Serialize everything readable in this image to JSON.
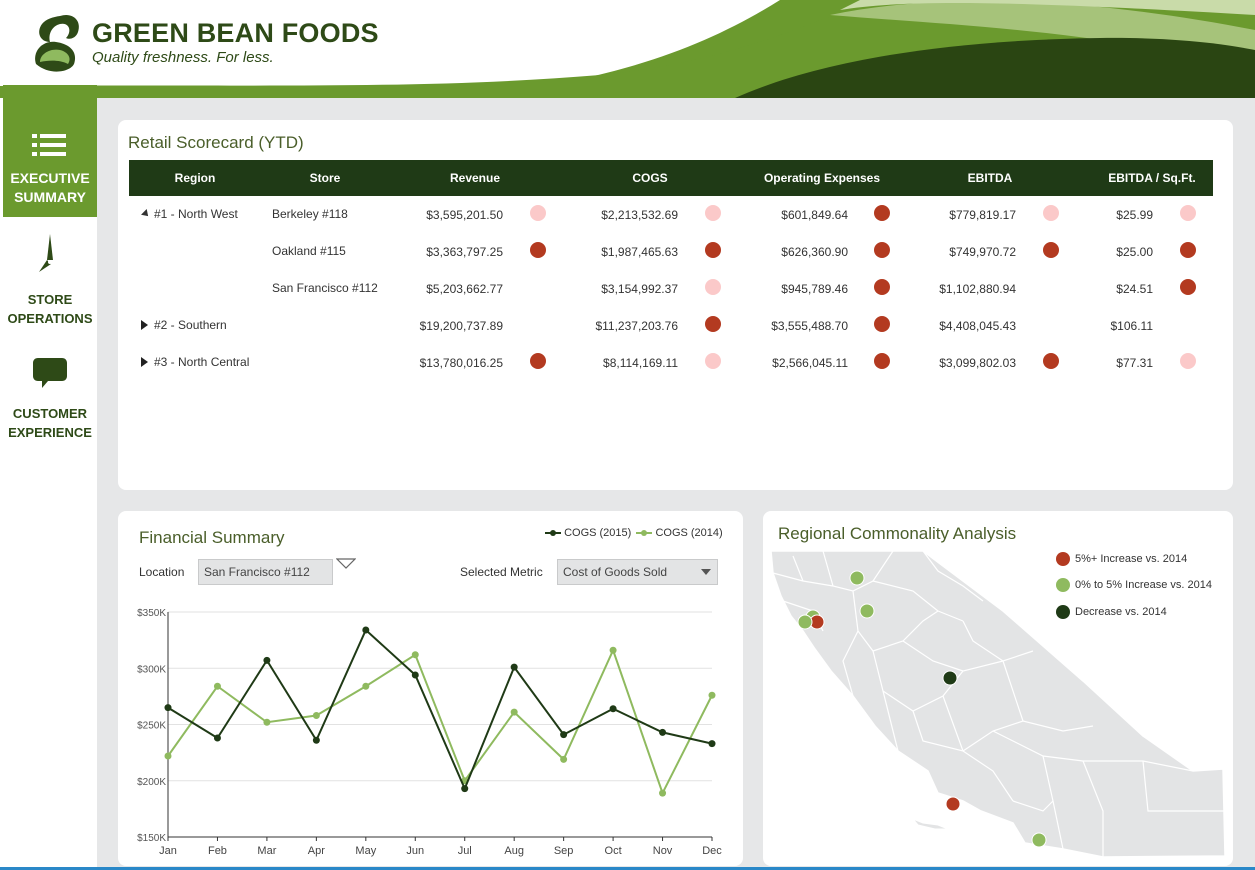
{
  "brand": {
    "name": "GREEN BEAN FOODS",
    "tagline": "Quality freshness. For less."
  },
  "colors": {
    "dark_green": "#1f3a16",
    "mid_green": "#6b9a2e",
    "light_green": "#8fba5f",
    "red": "#b33a20",
    "pink": "#fbc9c9"
  },
  "sidebar": {
    "items": [
      {
        "label_1": "EXECUTIVE",
        "label_2": "SUMMARY",
        "icon": "list-icon",
        "active": true
      },
      {
        "label_1": "STORE",
        "label_2": "OPERATIONS",
        "icon": "compass-icon",
        "active": false
      },
      {
        "label_1": "CUSTOMER",
        "label_2": "EXPERIENCE",
        "icon": "speech-bubble-icon",
        "active": false
      }
    ]
  },
  "scorecard": {
    "title": "Retail Scorecard (YTD)",
    "columns": [
      "Region",
      "Store",
      "Revenue",
      "COGS",
      "Operating Expenses",
      "EBITDA",
      "EBITDA / Sq.Ft."
    ],
    "rows": [
      {
        "region": "#1 - North West",
        "expanded": true,
        "store": "Berkeley #118",
        "revenue": "$3,595,201.50",
        "revenue_status": "pink",
        "cogs": "$2,213,532.69",
        "cogs_status": "pink",
        "opex": "$601,849.64",
        "opex_status": "red",
        "ebitda": "$779,819.17",
        "ebitda_status": "pink",
        "sqft": "$25.99",
        "sqft_status": "pink"
      },
      {
        "region": "",
        "store": "Oakland #115",
        "revenue": "$3,363,797.25",
        "revenue_status": "red",
        "cogs": "$1,987,465.63",
        "cogs_status": "red",
        "opex": "$626,360.90",
        "opex_status": "red",
        "ebitda": "$749,970.72",
        "ebitda_status": "red",
        "sqft": "$25.00",
        "sqft_status": "red"
      },
      {
        "region": "",
        "store": "San Francisco #112",
        "revenue": "$5,203,662.77",
        "revenue_status": "",
        "cogs": "$3,154,992.37",
        "cogs_status": "pink",
        "opex": "$945,789.46",
        "opex_status": "red",
        "ebitda": "$1,102,880.94",
        "ebitda_status": "",
        "sqft": "$24.51",
        "sqft_status": "red"
      },
      {
        "region": "#2 - Southern",
        "expanded": false,
        "store": "",
        "revenue": "$19,200,737.89",
        "revenue_status": "",
        "cogs": "$11,237,203.76",
        "cogs_status": "red",
        "opex": "$3,555,488.70",
        "opex_status": "red",
        "ebitda": "$4,408,045.43",
        "ebitda_status": "",
        "sqft": "$106.11",
        "sqft_status": ""
      },
      {
        "region": "#3 - North Central",
        "expanded": false,
        "store": "",
        "revenue": "$13,780,016.25",
        "revenue_status": "red",
        "cogs": "$8,114,169.11",
        "cogs_status": "pink",
        "opex": "$2,566,045.11",
        "opex_status": "red",
        "ebitda": "$3,099,802.03",
        "ebitda_status": "red",
        "sqft": "$77.31",
        "sqft_status": "pink"
      }
    ]
  },
  "financial": {
    "title": "Financial Summary",
    "location_label": "Location",
    "location_value": "San Francisco #112",
    "metric_label": "Selected Metric",
    "metric_value": "Cost of Goods Sold"
  },
  "chart_data": {
    "type": "line",
    "title": "",
    "xlabel": "",
    "ylabel": "",
    "categories": [
      "Jan",
      "Feb",
      "Mar",
      "Apr",
      "May",
      "Jun",
      "Jul",
      "Aug",
      "Sep",
      "Oct",
      "Nov",
      "Dec"
    ],
    "y_ticks": [
      "$150K",
      "$200K",
      "$250K",
      "$300K",
      "$350K"
    ],
    "ylim": [
      150000,
      350000
    ],
    "legend_position": "top-right",
    "grid": true,
    "series": [
      {
        "name": "COGS (2015)",
        "color": "#1f3a16",
        "values": [
          265000,
          238000,
          307000,
          236000,
          334000,
          294000,
          193000,
          301000,
          241000,
          264000,
          243000,
          233000
        ]
      },
      {
        "name": "COGS (2014)",
        "color": "#8fba5f",
        "values": [
          222000,
          284000,
          252000,
          258000,
          284000,
          312000,
          200000,
          261000,
          219000,
          316000,
          189000,
          276000
        ]
      }
    ]
  },
  "map": {
    "title": "Regional Commonality Analysis",
    "legend": [
      {
        "label": "5%+ Increase vs. 2014",
        "color": "#b33a20"
      },
      {
        "label": "0% to 5% Increase vs. 2014",
        "color": "#8fba5f"
      },
      {
        "label": "Decrease vs. 2014",
        "color": "#1f3a16"
      }
    ]
  }
}
